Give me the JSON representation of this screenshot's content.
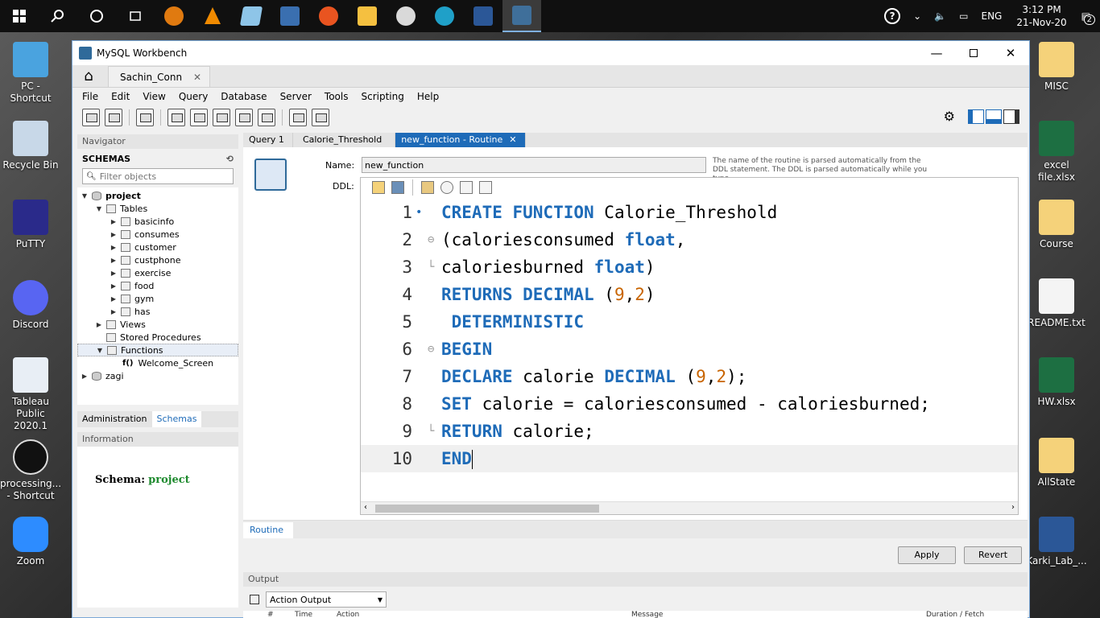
{
  "taskbar": {
    "tray": {
      "lang": "ENG",
      "time": "3:12 PM",
      "date": "21-Nov-20",
      "notif_count": "2"
    }
  },
  "desktop_left": [
    {
      "label": "PC - Shortcut"
    },
    {
      "label": "Recycle Bin"
    },
    {
      "label": "PuTTY"
    },
    {
      "label": "Discord"
    },
    {
      "label": "Tableau Public 2020.1"
    },
    {
      "label": "processing... - Shortcut"
    },
    {
      "label": "Zoom"
    }
  ],
  "desktop_right": [
    {
      "label": "MISC"
    },
    {
      "label": "excel file.xlsx"
    },
    {
      "label": "Course"
    },
    {
      "label": "README.txt"
    },
    {
      "label": "HW.xlsx"
    },
    {
      "label": "AllState"
    },
    {
      "label": "Karki_Lab_..."
    }
  ],
  "window": {
    "title": "MySQL Workbench",
    "conn_tab": "Sachin_Conn",
    "menu": [
      "File",
      "Edit",
      "View",
      "Query",
      "Database",
      "Server",
      "Tools",
      "Scripting",
      "Help"
    ]
  },
  "navigator": {
    "header": "Navigator",
    "schemas_title": "SCHEMAS",
    "filter_placeholder": "Filter objects",
    "tree": {
      "project": "project",
      "tables": "Tables",
      "table_items": [
        "basicinfo",
        "consumes",
        "customer",
        "custphone",
        "exercise",
        "food",
        "gym",
        "has"
      ],
      "views": "Views",
      "stored_procedures": "Stored Procedures",
      "functions": "Functions",
      "function_items": [
        "Welcome_Screen"
      ],
      "other_schema": "zagi"
    },
    "tabs": [
      "Administration",
      "Schemas"
    ],
    "info_header": "Information",
    "info_label": "Schema:",
    "info_value": "project"
  },
  "editor": {
    "tabs": [
      "Query 1",
      "Calorie_Threshold",
      "new_function - Routine"
    ],
    "name_label": "Name:",
    "name_value": "new_function",
    "hint": "The name of the routine is parsed automatically from the DDL statement. The DDL is parsed automatically while you type.",
    "ddl_label": "DDL:",
    "code_lines": [
      [
        {
          "t": "CREATE FUNCTION",
          "c": "kw"
        },
        {
          "t": " Calorie_Threshold",
          "c": ""
        }
      ],
      [
        {
          "t": "(caloriesconsumed ",
          "c": ""
        },
        {
          "t": "float",
          "c": "kw"
        },
        {
          "t": ",",
          "c": ""
        }
      ],
      [
        {
          "t": "caloriesburned ",
          "c": ""
        },
        {
          "t": "float",
          "c": "kw"
        },
        {
          "t": ")",
          "c": ""
        }
      ],
      [
        {
          "t": "RETURNS DECIMAL",
          "c": "kw"
        },
        {
          "t": " (",
          "c": ""
        },
        {
          "t": "9",
          "c": "num"
        },
        {
          "t": ",",
          "c": ""
        },
        {
          "t": "2",
          "c": "num"
        },
        {
          "t": ")",
          "c": ""
        }
      ],
      [
        {
          "t": " DETERMINISTIC",
          "c": "kw"
        }
      ],
      [
        {
          "t": "BEGIN",
          "c": "kw"
        }
      ],
      [
        {
          "t": "DECLARE",
          "c": "kw"
        },
        {
          "t": " calorie ",
          "c": ""
        },
        {
          "t": "DECIMAL",
          "c": "kw"
        },
        {
          "t": " (",
          "c": ""
        },
        {
          "t": "9",
          "c": "num"
        },
        {
          "t": ",",
          "c": ""
        },
        {
          "t": "2",
          "c": "num"
        },
        {
          "t": ");",
          "c": ""
        }
      ],
      [
        {
          "t": "SET",
          "c": "kw"
        },
        {
          "t": " calorie = caloriesconsumed - caloriesburned;",
          "c": ""
        }
      ],
      [
        {
          "t": "RETURN",
          "c": "kw"
        },
        {
          "t": " calorie;",
          "c": ""
        }
      ],
      [
        {
          "t": "END",
          "c": "kw"
        }
      ]
    ],
    "bottom_tab": "Routine",
    "apply": "Apply",
    "revert": "Revert"
  },
  "output": {
    "header": "Output",
    "select_value": "Action Output",
    "columns": [
      "#",
      "Time",
      "Action",
      "Message",
      "Duration / Fetch"
    ]
  }
}
